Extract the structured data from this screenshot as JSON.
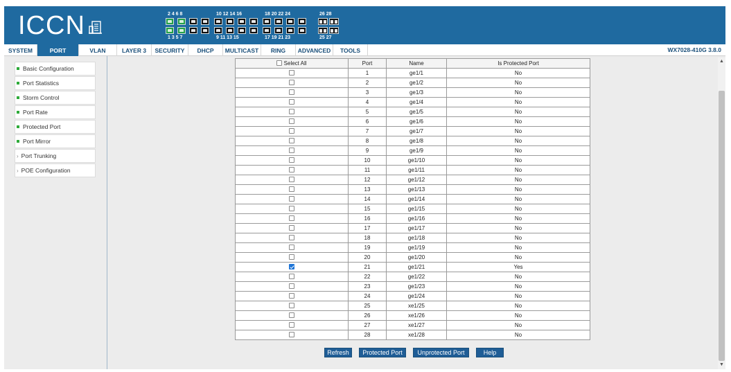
{
  "header": {
    "logo_text": "ICCN",
    "ports": {
      "top_group1": "2  4  6  8",
      "top_group2": "10 12 14 16",
      "top_group3": "18 20 22 24",
      "top_group4": "26 28",
      "bottom_group1": "1  3  5  7",
      "bottom_group2": "9  11 13 15",
      "bottom_group3": "17 19 21 23",
      "bottom_group4": "25 27",
      "up_ports": [
        1,
        2,
        3,
        4
      ]
    }
  },
  "nav": {
    "tabs": [
      "SYSTEM",
      "PORT",
      "VLAN",
      "LAYER 3",
      "SECURITY",
      "DHCP",
      "MULTICAST",
      "RING",
      "ADVANCED",
      "TOOLS"
    ],
    "active": "PORT",
    "model": "WX7028-410G 3.8.0"
  },
  "sidebar": {
    "items": [
      {
        "label": "Basic Configuration",
        "icon": "green-square-icon"
      },
      {
        "label": "Port Statistics",
        "icon": "green-square-icon"
      },
      {
        "label": "Storm Control",
        "icon": "green-square-icon"
      },
      {
        "label": "Port Rate",
        "icon": "green-square-icon"
      },
      {
        "label": "Protected Port",
        "icon": "green-square-icon"
      },
      {
        "label": "Port Mirror",
        "icon": "green-square-icon"
      },
      {
        "label": "Port Trunking",
        "icon": "chevron-right-icon"
      },
      {
        "label": "POE Configuration",
        "icon": "chevron-right-icon"
      }
    ]
  },
  "table": {
    "headers": {
      "select": "Select All",
      "port": "Port",
      "name": "Name",
      "protected": "Is Protected Port"
    },
    "rows": [
      {
        "port": "1",
        "name": "ge1/1",
        "protected": "No",
        "checked": false
      },
      {
        "port": "2",
        "name": "ge1/2",
        "protected": "No",
        "checked": false
      },
      {
        "port": "3",
        "name": "ge1/3",
        "protected": "No",
        "checked": false
      },
      {
        "port": "4",
        "name": "ge1/4",
        "protected": "No",
        "checked": false
      },
      {
        "port": "5",
        "name": "ge1/5",
        "protected": "No",
        "checked": false
      },
      {
        "port": "6",
        "name": "ge1/6",
        "protected": "No",
        "checked": false
      },
      {
        "port": "7",
        "name": "ge1/7",
        "protected": "No",
        "checked": false
      },
      {
        "port": "8",
        "name": "ge1/8",
        "protected": "No",
        "checked": false
      },
      {
        "port": "9",
        "name": "ge1/9",
        "protected": "No",
        "checked": false
      },
      {
        "port": "10",
        "name": "ge1/10",
        "protected": "No",
        "checked": false
      },
      {
        "port": "11",
        "name": "ge1/11",
        "protected": "No",
        "checked": false
      },
      {
        "port": "12",
        "name": "ge1/12",
        "protected": "No",
        "checked": false
      },
      {
        "port": "13",
        "name": "ge1/13",
        "protected": "No",
        "checked": false
      },
      {
        "port": "14",
        "name": "ge1/14",
        "protected": "No",
        "checked": false
      },
      {
        "port": "15",
        "name": "ge1/15",
        "protected": "No",
        "checked": false
      },
      {
        "port": "16",
        "name": "ge1/16",
        "protected": "No",
        "checked": false
      },
      {
        "port": "17",
        "name": "ge1/17",
        "protected": "No",
        "checked": false
      },
      {
        "port": "18",
        "name": "ge1/18",
        "protected": "No",
        "checked": false
      },
      {
        "port": "19",
        "name": "ge1/19",
        "protected": "No",
        "checked": false
      },
      {
        "port": "20",
        "name": "ge1/20",
        "protected": "No",
        "checked": false
      },
      {
        "port": "21",
        "name": "ge1/21",
        "protected": "Yes",
        "checked": true
      },
      {
        "port": "22",
        "name": "ge1/22",
        "protected": "No",
        "checked": false
      },
      {
        "port": "23",
        "name": "ge1/23",
        "protected": "No",
        "checked": false
      },
      {
        "port": "24",
        "name": "ge1/24",
        "protected": "No",
        "checked": false
      },
      {
        "port": "25",
        "name": "xe1/25",
        "protected": "No",
        "checked": false
      },
      {
        "port": "26",
        "name": "xe1/26",
        "protected": "No",
        "checked": false
      },
      {
        "port": "27",
        "name": "xe1/27",
        "protected": "No",
        "checked": false
      },
      {
        "port": "28",
        "name": "xe1/28",
        "protected": "No",
        "checked": false
      }
    ]
  },
  "actions": {
    "refresh": "Refresh",
    "protected": "Protected Port",
    "unprotected": "Unprotected Port",
    "help": "Help"
  },
  "colors": {
    "header_bg": "#1f6aa0",
    "button_bg": "#1f5d96",
    "bullet": "#2eaa3a"
  }
}
